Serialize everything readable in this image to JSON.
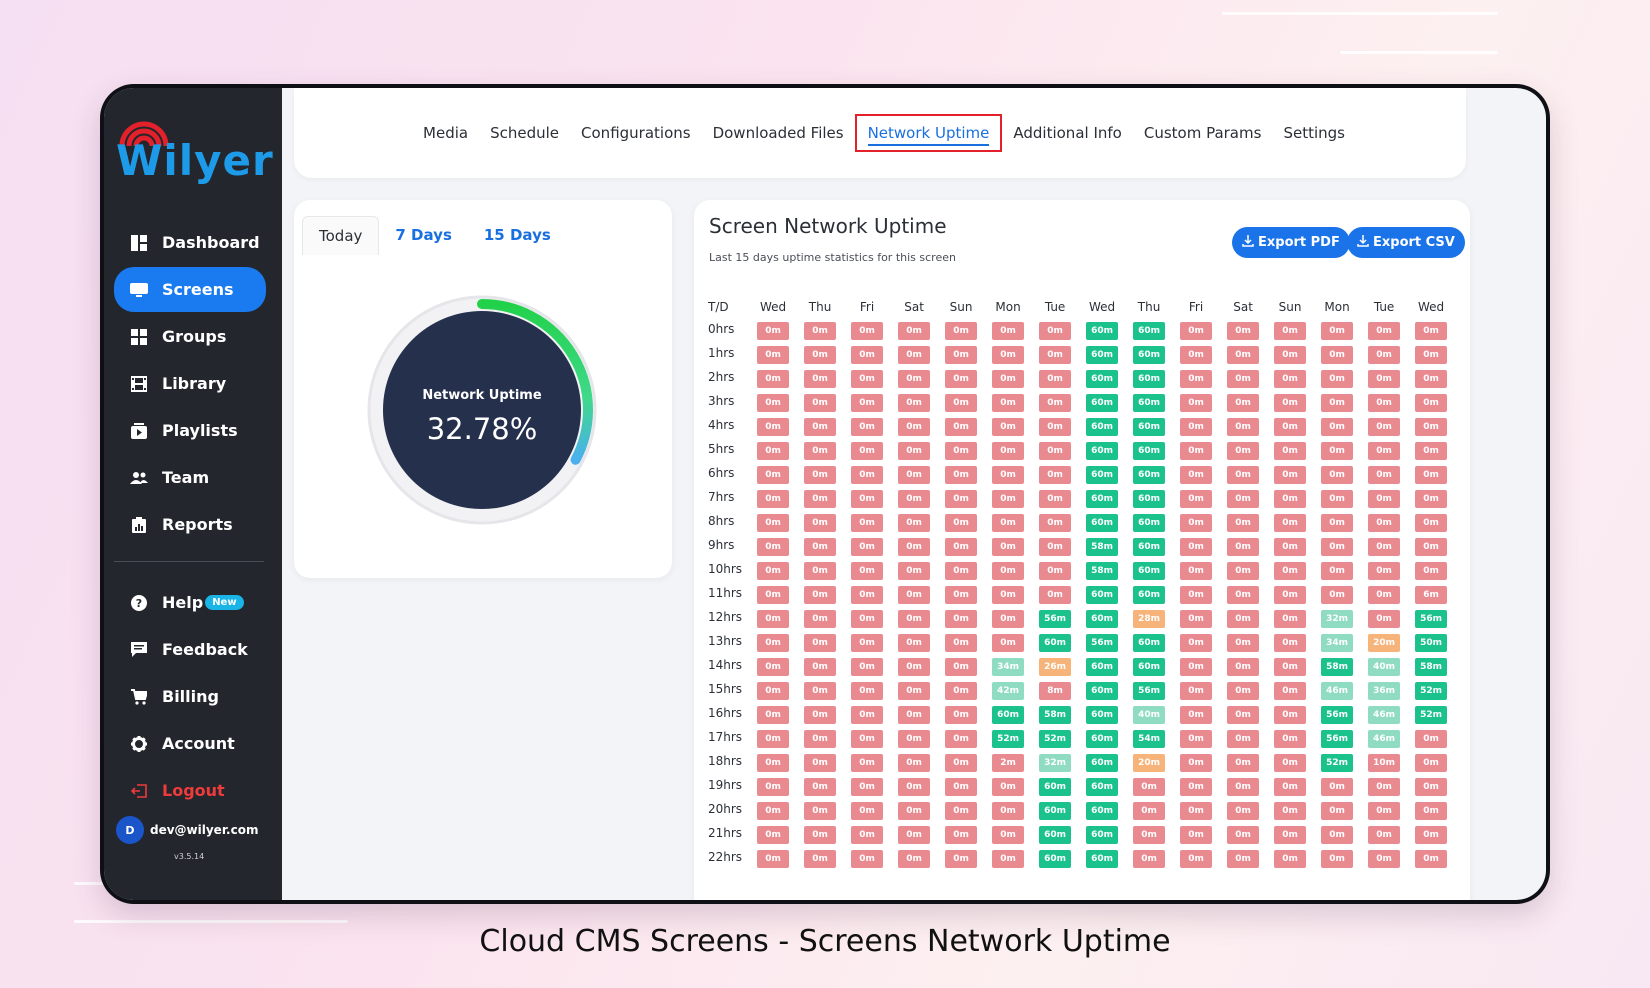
{
  "sidebar": {
    "logo": "Wilyer",
    "items": [
      {
        "label": "Dashboard",
        "icon": "dashboard-icon",
        "active": false
      },
      {
        "label": "Screens",
        "icon": "screen-icon",
        "active": true
      },
      {
        "label": "Groups",
        "icon": "groups-icon",
        "active": false
      },
      {
        "label": "Library",
        "icon": "film-icon",
        "active": false
      },
      {
        "label": "Playlists",
        "icon": "playlist-icon",
        "active": false
      },
      {
        "label": "Team",
        "icon": "team-icon",
        "active": false
      },
      {
        "label": "Reports",
        "icon": "reports-icon",
        "active": false
      }
    ],
    "bottom_items": [
      {
        "label": "Help",
        "icon": "help-icon",
        "badge": "New"
      },
      {
        "label": "Feedback",
        "icon": "feedback-icon"
      },
      {
        "label": "Billing",
        "icon": "cart-icon"
      },
      {
        "label": "Account",
        "icon": "gear-icon"
      },
      {
        "label": "Logout",
        "icon": "logout-icon"
      }
    ],
    "user": {
      "initial": "D",
      "email": "dev@wilyer.com"
    },
    "version": "v3.5.14"
  },
  "topbar": {
    "tabs": [
      "Media",
      "Schedule",
      "Configurations",
      "Downloaded Files",
      "Network Uptime",
      "Additional Info",
      "Custom Params",
      "Settings"
    ],
    "active_index": 4
  },
  "left_card": {
    "periods": [
      "Today",
      "7 Days",
      "15 Days"
    ],
    "active_period": 0,
    "gauge_label": "Network Uptime",
    "gauge_value": "32.78%",
    "gauge_fraction": 0.3278
  },
  "uptime": {
    "title": "Screen Network Uptime",
    "subtitle": "Last 15 days uptime statistics for this screen",
    "export_pdf": "Export PDF",
    "export_csv": "Export CSV",
    "corner_label": "T/D",
    "days": [
      "Wed",
      "Thu",
      "Fri",
      "Sat",
      "Sun",
      "Mon",
      "Tue",
      "Wed",
      "Thu",
      "Fri",
      "Sat",
      "Sun",
      "Mon",
      "Tue",
      "Wed"
    ],
    "hours": [
      "0hrs",
      "1hrs",
      "2hrs",
      "3hrs",
      "4hrs",
      "5hrs",
      "6hrs",
      "7hrs",
      "8hrs",
      "9hrs",
      "10hrs",
      "11hrs",
      "12hrs",
      "13hrs",
      "14hrs",
      "15hrs",
      "16hrs",
      "17hrs",
      "18hrs",
      "19hrs",
      "20hrs",
      "21hrs",
      "22hrs"
    ],
    "rows": [
      [
        "0m",
        "0m",
        "0m",
        "0m",
        "0m",
        "0m",
        "0m",
        "60m",
        "60m",
        "0m",
        "0m",
        "0m",
        "0m",
        "0m",
        "0m"
      ],
      [
        "0m",
        "0m",
        "0m",
        "0m",
        "0m",
        "0m",
        "0m",
        "60m",
        "60m",
        "0m",
        "0m",
        "0m",
        "0m",
        "0m",
        "0m"
      ],
      [
        "0m",
        "0m",
        "0m",
        "0m",
        "0m",
        "0m",
        "0m",
        "60m",
        "60m",
        "0m",
        "0m",
        "0m",
        "0m",
        "0m",
        "0m"
      ],
      [
        "0m",
        "0m",
        "0m",
        "0m",
        "0m",
        "0m",
        "0m",
        "60m",
        "60m",
        "0m",
        "0m",
        "0m",
        "0m",
        "0m",
        "0m"
      ],
      [
        "0m",
        "0m",
        "0m",
        "0m",
        "0m",
        "0m",
        "0m",
        "60m",
        "60m",
        "0m",
        "0m",
        "0m",
        "0m",
        "0m",
        "0m"
      ],
      [
        "0m",
        "0m",
        "0m",
        "0m",
        "0m",
        "0m",
        "0m",
        "60m",
        "60m",
        "0m",
        "0m",
        "0m",
        "0m",
        "0m",
        "0m"
      ],
      [
        "0m",
        "0m",
        "0m",
        "0m",
        "0m",
        "0m",
        "0m",
        "60m",
        "60m",
        "0m",
        "0m",
        "0m",
        "0m",
        "0m",
        "0m"
      ],
      [
        "0m",
        "0m",
        "0m",
        "0m",
        "0m",
        "0m",
        "0m",
        "60m",
        "60m",
        "0m",
        "0m",
        "0m",
        "0m",
        "0m",
        "0m"
      ],
      [
        "0m",
        "0m",
        "0m",
        "0m",
        "0m",
        "0m",
        "0m",
        "60m",
        "60m",
        "0m",
        "0m",
        "0m",
        "0m",
        "0m",
        "0m"
      ],
      [
        "0m",
        "0m",
        "0m",
        "0m",
        "0m",
        "0m",
        "0m",
        "58m",
        "60m",
        "0m",
        "0m",
        "0m",
        "0m",
        "0m",
        "0m"
      ],
      [
        "0m",
        "0m",
        "0m",
        "0m",
        "0m",
        "0m",
        "0m",
        "58m",
        "60m",
        "0m",
        "0m",
        "0m",
        "0m",
        "0m",
        "0m"
      ],
      [
        "0m",
        "0m",
        "0m",
        "0m",
        "0m",
        "0m",
        "0m",
        "60m",
        "60m",
        "0m",
        "0m",
        "0m",
        "0m",
        "0m",
        "6m"
      ],
      [
        "0m",
        "0m",
        "0m",
        "0m",
        "0m",
        "0m",
        "56m",
        "60m",
        "28m",
        "0m",
        "0m",
        "0m",
        "32m",
        "0m",
        "56m"
      ],
      [
        "0m",
        "0m",
        "0m",
        "0m",
        "0m",
        "0m",
        "60m",
        "56m",
        "60m",
        "0m",
        "0m",
        "0m",
        "34m",
        "20m",
        "50m"
      ],
      [
        "0m",
        "0m",
        "0m",
        "0m",
        "0m",
        "34m",
        "26m",
        "60m",
        "60m",
        "0m",
        "0m",
        "0m",
        "58m",
        "40m",
        "58m"
      ],
      [
        "0m",
        "0m",
        "0m",
        "0m",
        "0m",
        "42m",
        "8m",
        "60m",
        "56m",
        "0m",
        "0m",
        "0m",
        "46m",
        "36m",
        "52m"
      ],
      [
        "0m",
        "0m",
        "0m",
        "0m",
        "0m",
        "60m",
        "58m",
        "60m",
        "40m",
        "0m",
        "0m",
        "0m",
        "56m",
        "46m",
        "52m"
      ],
      [
        "0m",
        "0m",
        "0m",
        "0m",
        "0m",
        "52m",
        "52m",
        "60m",
        "54m",
        "0m",
        "0m",
        "0m",
        "56m",
        "46m",
        "0m"
      ],
      [
        "0m",
        "0m",
        "0m",
        "0m",
        "0m",
        "2m",
        "32m",
        "60m",
        "20m",
        "0m",
        "0m",
        "0m",
        "52m",
        "10m",
        "0m"
      ],
      [
        "0m",
        "0m",
        "0m",
        "0m",
        "0m",
        "0m",
        "60m",
        "60m",
        "0m",
        "0m",
        "0m",
        "0m",
        "0m",
        "0m",
        "0m"
      ],
      [
        "0m",
        "0m",
        "0m",
        "0m",
        "0m",
        "0m",
        "60m",
        "60m",
        "0m",
        "0m",
        "0m",
        "0m",
        "0m",
        "0m",
        "0m"
      ],
      [
        "0m",
        "0m",
        "0m",
        "0m",
        "0m",
        "0m",
        "60m",
        "60m",
        "0m",
        "0m",
        "0m",
        "0m",
        "0m",
        "0m",
        "0m"
      ],
      [
        "0m",
        "0m",
        "0m",
        "0m",
        "0m",
        "0m",
        "60m",
        "60m",
        "0m",
        "0m",
        "0m",
        "0m",
        "0m",
        "0m",
        "0m"
      ]
    ]
  },
  "caption": "Cloud CMS Screens - Screens Network Uptime",
  "colors": {
    "accent": "#1a73e8",
    "sidebar": "#23262d",
    "offline": "#e98a90",
    "online": "#1cc28c",
    "partial": "#8fdcc3",
    "low": "#f6b37a"
  }
}
